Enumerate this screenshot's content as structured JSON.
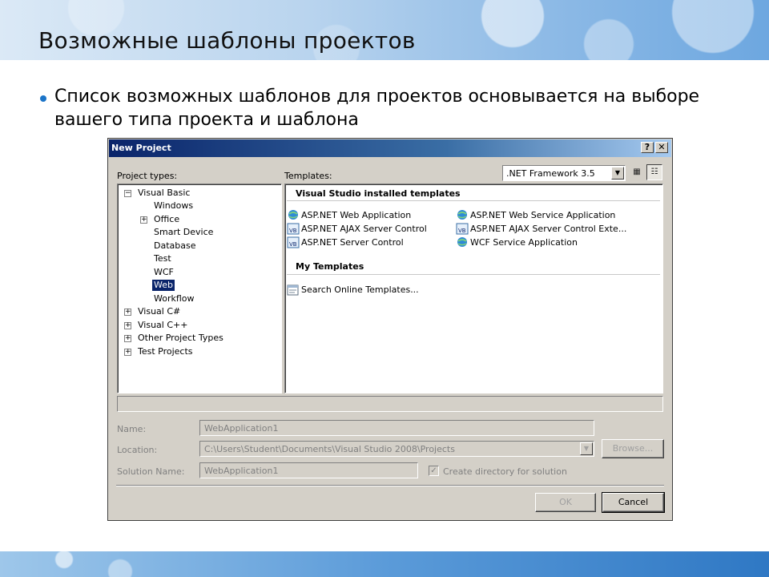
{
  "slide": {
    "title": "Возможные шаблоны проектов",
    "bullet": "Список возможных шаблонов для проектов основывается на выборе вашего типа проекта и шаблона",
    "bullet_color": "#1b74c8"
  },
  "dialog": {
    "title": "New Project",
    "help_label": "?",
    "close_label": "✕",
    "project_types_label": "Project types:",
    "templates_label": "Templates:",
    "framework": {
      "selected": ".NET Framework 3.5",
      "arrow": "▼"
    },
    "view_buttons": {
      "large_icons": "▦",
      "small_icons": "☷"
    },
    "tree": {
      "visual_basic": {
        "label": "Visual Basic",
        "expander": "−"
      },
      "windows": {
        "label": "Windows"
      },
      "office": {
        "label": "Office",
        "expander": "+"
      },
      "smart_device": {
        "label": "Smart Device"
      },
      "database": {
        "label": "Database"
      },
      "test": {
        "label": "Test"
      },
      "wcf": {
        "label": "WCF"
      },
      "web": {
        "label": "Web"
      },
      "workflow": {
        "label": "Workflow"
      },
      "visual_csharp": {
        "label": "Visual C#",
        "expander": "+"
      },
      "visual_cpp": {
        "label": "Visual C++",
        "expander": "+"
      },
      "other_types": {
        "label": "Other Project Types",
        "expander": "+"
      },
      "test_projects": {
        "label": "Test Projects",
        "expander": "+"
      }
    },
    "templates": {
      "installed_header": "Visual Studio installed templates",
      "my_header": "My Templates",
      "items": {
        "aspnet_web_app": {
          "label": "ASP.NET Web Application",
          "icon": "web-project-icon"
        },
        "aspnet_ajax_control": {
          "label": "ASP.NET AJAX Server Control",
          "icon": "vb-control-icon"
        },
        "aspnet_server_control": {
          "label": "ASP.NET Server Control",
          "icon": "vb-control-icon"
        },
        "aspnet_web_service": {
          "label": "ASP.NET Web Service Application",
          "icon": "web-project-icon"
        },
        "aspnet_ajax_extender": {
          "label": "ASP.NET AJAX Server Control Exte...",
          "icon": "vb-control-icon"
        },
        "wcf_service": {
          "label": "WCF Service Application",
          "icon": "web-project-icon"
        },
        "search_online": {
          "label": "Search Online Templates...",
          "icon": "search-templates-icon"
        }
      }
    },
    "form": {
      "name_label": "Name:",
      "name_value": "WebApplication1",
      "location_label": "Location:",
      "location_value": "C:\\Users\\Student\\Documents\\Visual Studio 2008\\Projects",
      "location_arrow": "▼",
      "browse_label": "Browse...",
      "solution_label": "Solution Name:",
      "solution_value": "WebApplication1",
      "create_dir_label": "Create directory for solution",
      "create_dir_check": "✓"
    },
    "ok_label": "OK",
    "cancel_label": "Cancel"
  }
}
